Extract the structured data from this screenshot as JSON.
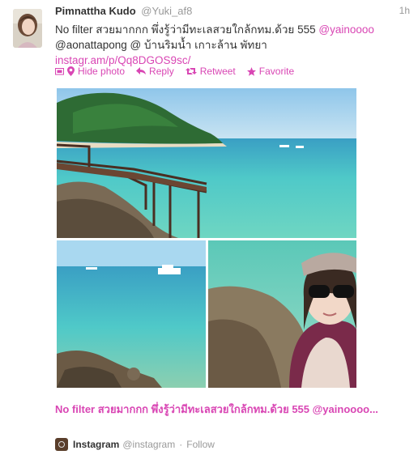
{
  "tweet": {
    "author_name": "Pimnattha Kudo",
    "author_handle": "@Yuki_af8",
    "time": "1h",
    "text_line1": "No filter สวยมากกก พึ่งรู้ว่ามีทะเลสวยใกล้กทม.ด้วย 555 ",
    "mention_1": "@yainoooo",
    "text_line2": "@aonattapong @ บ้านริมน้ำ เกาะล้าน พัทยา",
    "link": "instagr.am/p/Qq8DGOS9sc/"
  },
  "actions": {
    "hide_photo": "Hide photo",
    "reply": "Reply",
    "retweet": "Retweet",
    "favorite": "Favorite"
  },
  "card": {
    "title": "No filter สวยมากกก พึ่งรู้ว่ามีทะเลสวยใกล้กทม.ด้วย 555 @yainoooo...",
    "source_name": "Instagram",
    "source_handle": "@instagram",
    "follow": "Follow"
  },
  "colors": {
    "accent": "#d946b4",
    "muted": "#999999",
    "sea": "#4fc9c8",
    "sky": "#a9d8f0"
  },
  "icons": [
    "photo-icon",
    "location-pin-icon",
    "reply-icon",
    "retweet-icon",
    "star-icon",
    "instagram-icon"
  ]
}
